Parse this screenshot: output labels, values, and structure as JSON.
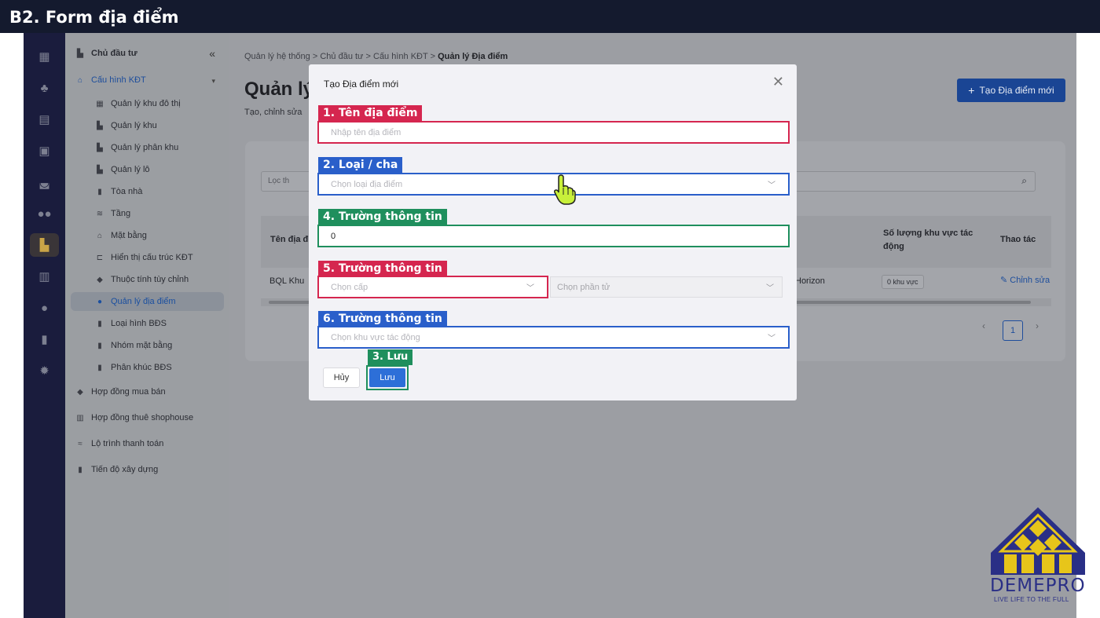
{
  "header": {
    "title": "B2. Form địa điểm"
  },
  "rail": {
    "icons": [
      "building-icon",
      "tree-icon",
      "calculator-icon",
      "briefcase-icon",
      "car-icon",
      "users-icon",
      "map-building-icon",
      "store-icon",
      "user-icon",
      "bar-chart-icon",
      "gear-icon"
    ],
    "active_index": 6
  },
  "sidebar": {
    "collapse_glyph": "«",
    "items": [
      {
        "label": "Chủ đầu tư",
        "level": "top"
      },
      {
        "label": "Cấu hình KĐT",
        "level": "group"
      },
      {
        "label": "Quản lý khu đô thị",
        "level": "sub"
      },
      {
        "label": "Quản lý khu",
        "level": "sub"
      },
      {
        "label": "Quản lý phân khu",
        "level": "sub"
      },
      {
        "label": "Quản lý lô",
        "level": "sub"
      },
      {
        "label": "Tòa nhà",
        "level": "sub"
      },
      {
        "label": "Tầng",
        "level": "sub"
      },
      {
        "label": "Mặt bằng",
        "level": "sub"
      },
      {
        "label": "Hiển thị cấu trúc KĐT",
        "level": "sub"
      },
      {
        "label": "Thuộc tính tùy chỉnh",
        "level": "sub"
      },
      {
        "label": "Quản lý địa điểm",
        "level": "sub",
        "selected": true
      },
      {
        "label": "Loại hình BĐS",
        "level": "sub"
      },
      {
        "label": "Nhóm mặt bằng",
        "level": "sub"
      },
      {
        "label": "Phân khúc BĐS",
        "level": "sub"
      },
      {
        "label": "Hợp đồng mua bán",
        "level": "top"
      },
      {
        "label": "Hợp đồng thuê shophouse",
        "level": "top"
      },
      {
        "label": "Lộ trình thanh toán",
        "level": "top"
      },
      {
        "label": "Tiến độ xây dựng",
        "level": "top"
      }
    ]
  },
  "page": {
    "breadcrumb": {
      "b1": "Quản lý hệ thống",
      "b2": "Chủ đầu tư",
      "b3": "Cấu hình KĐT",
      "b4": "Quản lý Địa điểm",
      "sep": ">"
    },
    "title": "Quản lý",
    "subtitle": "Tạo, chỉnh sửa",
    "create_button": "Tạo Địa điểm mới",
    "filter_placeholder": "Lọc th",
    "table": {
      "col_name": "Tên địa đ",
      "col_count_1": "Số lượng khu vực tác",
      "col_count_2": "động",
      "col_actions": "Thao tác",
      "row": {
        "name": "BQL Khu",
        "partner": "Horizon",
        "count": "0 khu vực",
        "action": "Chỉnh sửa"
      }
    },
    "pagination": {
      "prev": "‹",
      "current": "1",
      "next": "›"
    }
  },
  "modal": {
    "title": "Tạo Địa điểm mới",
    "close": "✕",
    "fields": {
      "name": {
        "tag": "1. Tên địa điểm",
        "placeholder": "Nhập tên địa điểm"
      },
      "type": {
        "tag": "2. Loại / cha",
        "placeholder": "Chọn loại địa điểm"
      },
      "info4": {
        "tag": "4. Trường thông tin",
        "value": "0"
      },
      "info5": {
        "tag": "5. Trường thông tin",
        "placeholder": "Chọn cấp",
        "secondary_placeholder": "Chọn phần tử"
      },
      "info6": {
        "tag": "6. Trường thông tin",
        "placeholder": "Chọn khu vực tác động"
      }
    },
    "save_tag": "3. Lưu",
    "cancel_label": "Hủy",
    "save_label": "Lưu"
  },
  "logo": {
    "name": "DEMEPRO",
    "slogan": "LIVE LIFE TO THE FULL"
  },
  "colors": {
    "red": "#d5264f",
    "blue": "#2a5fca",
    "green": "#1f8f5d",
    "brand": "#2a2f86"
  }
}
